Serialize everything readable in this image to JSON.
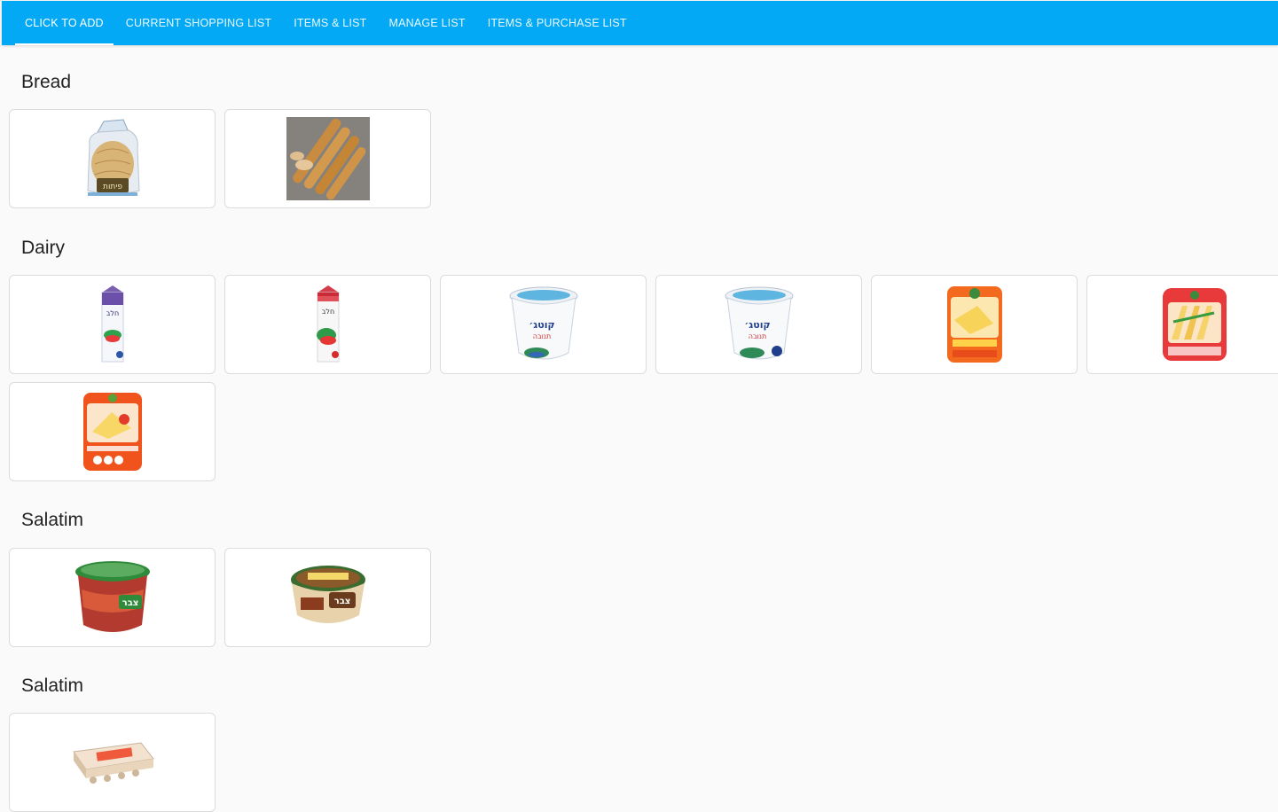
{
  "nav": {
    "tabs": [
      {
        "label": "CLICK TO ADD",
        "active": true
      },
      {
        "label": "CURRENT SHOPPING LIST",
        "active": false
      },
      {
        "label": "ITEMS & LIST",
        "active": false
      },
      {
        "label": "MANAGE LIST",
        "active": false
      },
      {
        "label": "ITEMS & PURCHASE LIST",
        "active": false
      }
    ]
  },
  "colors": {
    "appbar": "#03a9f4",
    "background": "#fafafa"
  },
  "sections": [
    {
      "title": "Bread",
      "items": [
        "pita-bag-image",
        "baguettes-image"
      ]
    },
    {
      "title": "Dairy",
      "items": [
        "milk-carton-blue-image",
        "milk-carton-red-image",
        "cottage-cheese-image",
        "cottage-cheese-5-image",
        "yellow-cheese-image",
        "sliced-cheese-image",
        "cheese-pack-image"
      ]
    },
    {
      "title": "Salatim",
      "items": [
        "tomato-salad-image",
        "hummus-image"
      ]
    },
    {
      "title": "Salatim",
      "items": [
        "eggs-carton-image"
      ]
    }
  ],
  "product_texts": {
    "pita": "פיתות",
    "milk": "חלב",
    "cottage": "קוטג׳",
    "tnuva": "תנובה",
    "tzabar": "צבר"
  }
}
